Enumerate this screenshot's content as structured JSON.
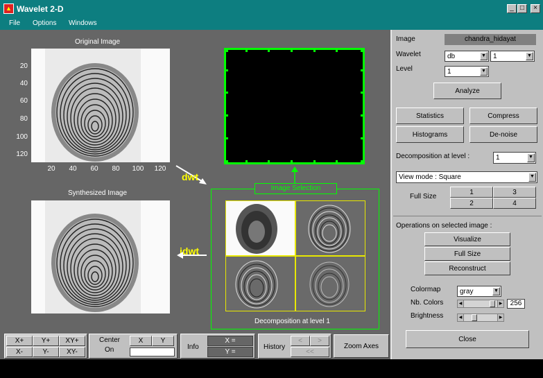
{
  "window": {
    "title": "Wavelet 2-D",
    "minimize": "_",
    "maximize": "□",
    "close": "×"
  },
  "menu": [
    "File",
    "Options",
    "Windows"
  ],
  "original": {
    "title": "Original Image",
    "yticks": [
      "20",
      "40",
      "60",
      "80",
      "100",
      "120"
    ],
    "xticks": [
      "20",
      "40",
      "60",
      "80",
      "100",
      "120"
    ]
  },
  "synth": {
    "title": "Synthesized Image"
  },
  "arrows": {
    "dwt": "dwt",
    "idwt": "idwt"
  },
  "selection": {
    "label": "Image Selection",
    "caption": "Decomposition at level 1"
  },
  "side": {
    "image_label": "Image",
    "image_value": "chandra_hidayat",
    "wavelet_label": "Wavelet",
    "wavelet_family": "db",
    "wavelet_order": "1",
    "level_label": "Level",
    "level_value": "1",
    "analyze": "Analyze",
    "statistics": "Statistics",
    "compress": "Compress",
    "histograms": "Histograms",
    "denoise": "De-noise",
    "decomp_label": "Decomposition at level :",
    "decomp_value": "1",
    "view_mode": "View mode : Square",
    "fullsize_label": "Full Size",
    "fs_buttons": [
      "1",
      "3",
      "2",
      "4"
    ],
    "ops_label": "Operations on selected image :",
    "visualize": "Visualize",
    "full_size": "Full Size",
    "reconstruct": "Reconstruct",
    "colormap_label": "Colormap",
    "colormap_value": "gray",
    "nbcolors_label": "Nb. Colors",
    "nbcolors_value": "256",
    "brightness_label": "Brightness",
    "close": "Close"
  },
  "toolbar": {
    "xplus": "X+",
    "yplus": "Y+",
    "xyplus": "XY+",
    "xminus": "X-",
    "yminus": "Y-",
    "xyminus": "XY-",
    "center": "Center",
    "on": "On",
    "x": "X",
    "y": "Y",
    "info": "Info",
    "xeq": "X =",
    "yeq": "Y =",
    "history": "History",
    "hist_back": "<",
    "hist_fwd": ">",
    "hist_start": "<<",
    "zoom": "Zoom Axes"
  }
}
